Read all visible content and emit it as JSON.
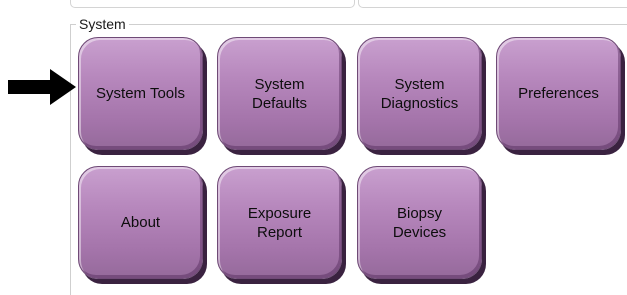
{
  "group": {
    "title": "System"
  },
  "tiles": [
    {
      "label_lines": [
        "System Tools"
      ]
    },
    {
      "label_lines": [
        "System",
        "Defaults"
      ]
    },
    {
      "label_lines": [
        "System",
        "Diagnostics"
      ]
    },
    {
      "label_lines": [
        "Preferences"
      ]
    },
    {
      "label_lines": [
        "About"
      ]
    },
    {
      "label_lines": [
        "Exposure",
        "Report"
      ]
    },
    {
      "label_lines": [
        "Biopsy Devices"
      ]
    }
  ],
  "colors": {
    "tile_top": "#c9a0cf",
    "tile_bottom": "#956a9b",
    "tile_shadow": "#3a2240",
    "arrow": "#000000"
  },
  "icons": {
    "callout_arrow": "arrow-right-icon"
  }
}
